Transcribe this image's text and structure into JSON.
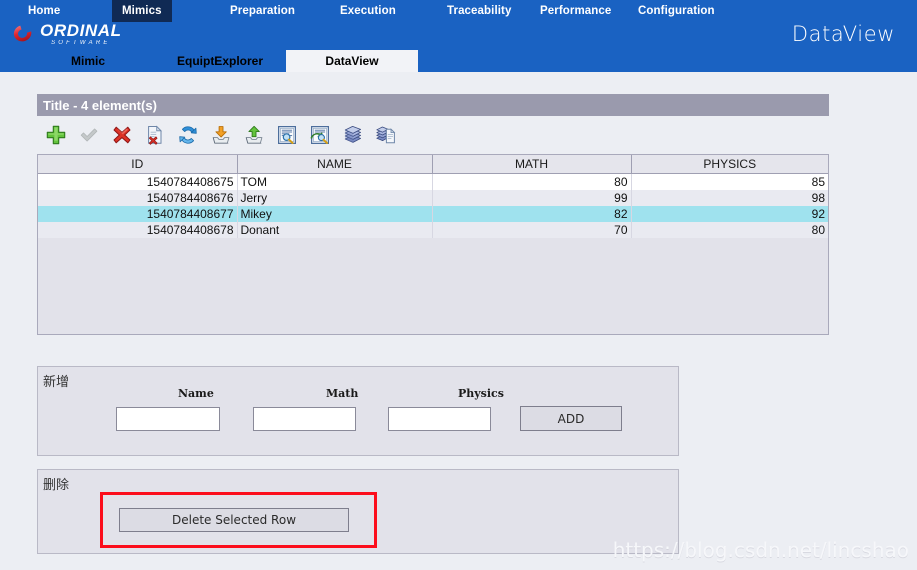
{
  "header": {
    "brand_title": "DataView",
    "logo": {
      "word": "ORDINAL",
      "sub": "SOFTWARE",
      "mark": "ordinal-ring-logo"
    },
    "main_nav": [
      {
        "label": "Home",
        "active": false
      },
      {
        "label": "Mimics",
        "active": true
      },
      {
        "label": "Preparation",
        "active": false
      },
      {
        "label": "Execution",
        "active": false
      },
      {
        "label": "Traceability",
        "active": false
      },
      {
        "label": "Performance",
        "active": false
      },
      {
        "label": "Configuration",
        "active": false
      }
    ],
    "sub_tabs": [
      {
        "label": "Mimic",
        "active": false
      },
      {
        "label": "EquiptExplorer",
        "active": false
      },
      {
        "label": "DataView",
        "active": true
      }
    ],
    "colors": {
      "header_blue": "#1a62c2",
      "active_nav_navy": "#102a54",
      "logo_red": "#d61f26"
    }
  },
  "grid_panel": {
    "title": "Title - 4 element(s)",
    "title_bar_color": "#9a9aad",
    "toolbar": [
      {
        "name": "add-icon",
        "tooltip": "Add"
      },
      {
        "name": "validate-check-icon",
        "tooltip": "Validate"
      },
      {
        "name": "delete-cross-icon",
        "tooltip": "Delete"
      },
      {
        "name": "delete-file-icon",
        "tooltip": "Delete file"
      },
      {
        "name": "refresh-icon",
        "tooltip": "Refresh"
      },
      {
        "name": "import-download-icon",
        "tooltip": "Import"
      },
      {
        "name": "export-upload-icon",
        "tooltip": "Export"
      },
      {
        "name": "view-report-icon",
        "tooltip": "View report"
      },
      {
        "name": "edit-report-icon",
        "tooltip": "Edit report"
      },
      {
        "name": "database-icon",
        "tooltip": "Database"
      },
      {
        "name": "database-copy-icon",
        "tooltip": "Copy database"
      }
    ],
    "columns": [
      "ID",
      "NAME",
      "MATH",
      "PHYSICS"
    ],
    "rows": [
      {
        "id": "1540784408675",
        "name": "TOM",
        "math": "80",
        "physics": "85",
        "selected": false
      },
      {
        "id": "1540784408676",
        "name": "Jerry",
        "math": "99",
        "physics": "98",
        "selected": false
      },
      {
        "id": "1540784408677",
        "name": "Mikey",
        "math": "82",
        "physics": "92",
        "selected": true
      },
      {
        "id": "1540784408678",
        "name": "Donant",
        "math": "70",
        "physics": "80",
        "selected": false
      }
    ],
    "selection_color": "#9fe2ee"
  },
  "add_panel": {
    "corner_label": "新增",
    "fields": {
      "name": {
        "label": "Name",
        "value": "",
        "placeholder": ""
      },
      "math": {
        "label": "Math",
        "value": "",
        "placeholder": ""
      },
      "physics": {
        "label": "Physics",
        "value": "",
        "placeholder": ""
      }
    },
    "add_button_label": "ADD"
  },
  "delete_panel": {
    "corner_label": "删除",
    "delete_button_label": "Delete Selected Row",
    "highlight_color": "#fc0d1c"
  },
  "watermark": {
    "text": "https://blog.csdn.net/lincshao"
  }
}
